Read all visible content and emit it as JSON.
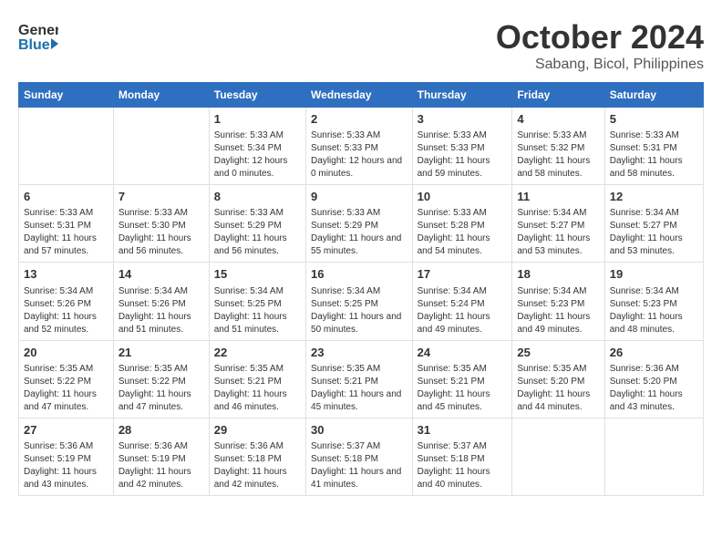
{
  "header": {
    "logo_line1": "General",
    "logo_line2": "Blue",
    "title": "October 2024",
    "subtitle": "Sabang, Bicol, Philippines"
  },
  "days_of_week": [
    "Sunday",
    "Monday",
    "Tuesday",
    "Wednesday",
    "Thursday",
    "Friday",
    "Saturday"
  ],
  "weeks": [
    [
      {
        "day": "",
        "sunrise": "",
        "sunset": "",
        "daylight": ""
      },
      {
        "day": "",
        "sunrise": "",
        "sunset": "",
        "daylight": ""
      },
      {
        "day": "1",
        "sunrise": "Sunrise: 5:33 AM",
        "sunset": "Sunset: 5:34 PM",
        "daylight": "Daylight: 12 hours and 0 minutes."
      },
      {
        "day": "2",
        "sunrise": "Sunrise: 5:33 AM",
        "sunset": "Sunset: 5:33 PM",
        "daylight": "Daylight: 12 hours and 0 minutes."
      },
      {
        "day": "3",
        "sunrise": "Sunrise: 5:33 AM",
        "sunset": "Sunset: 5:33 PM",
        "daylight": "Daylight: 11 hours and 59 minutes."
      },
      {
        "day": "4",
        "sunrise": "Sunrise: 5:33 AM",
        "sunset": "Sunset: 5:32 PM",
        "daylight": "Daylight: 11 hours and 58 minutes."
      },
      {
        "day": "5",
        "sunrise": "Sunrise: 5:33 AM",
        "sunset": "Sunset: 5:31 PM",
        "daylight": "Daylight: 11 hours and 58 minutes."
      }
    ],
    [
      {
        "day": "6",
        "sunrise": "Sunrise: 5:33 AM",
        "sunset": "Sunset: 5:31 PM",
        "daylight": "Daylight: 11 hours and 57 minutes."
      },
      {
        "day": "7",
        "sunrise": "Sunrise: 5:33 AM",
        "sunset": "Sunset: 5:30 PM",
        "daylight": "Daylight: 11 hours and 56 minutes."
      },
      {
        "day": "8",
        "sunrise": "Sunrise: 5:33 AM",
        "sunset": "Sunset: 5:29 PM",
        "daylight": "Daylight: 11 hours and 56 minutes."
      },
      {
        "day": "9",
        "sunrise": "Sunrise: 5:33 AM",
        "sunset": "Sunset: 5:29 PM",
        "daylight": "Daylight: 11 hours and 55 minutes."
      },
      {
        "day": "10",
        "sunrise": "Sunrise: 5:33 AM",
        "sunset": "Sunset: 5:28 PM",
        "daylight": "Daylight: 11 hours and 54 minutes."
      },
      {
        "day": "11",
        "sunrise": "Sunrise: 5:34 AM",
        "sunset": "Sunset: 5:27 PM",
        "daylight": "Daylight: 11 hours and 53 minutes."
      },
      {
        "day": "12",
        "sunrise": "Sunrise: 5:34 AM",
        "sunset": "Sunset: 5:27 PM",
        "daylight": "Daylight: 11 hours and 53 minutes."
      }
    ],
    [
      {
        "day": "13",
        "sunrise": "Sunrise: 5:34 AM",
        "sunset": "Sunset: 5:26 PM",
        "daylight": "Daylight: 11 hours and 52 minutes."
      },
      {
        "day": "14",
        "sunrise": "Sunrise: 5:34 AM",
        "sunset": "Sunset: 5:26 PM",
        "daylight": "Daylight: 11 hours and 51 minutes."
      },
      {
        "day": "15",
        "sunrise": "Sunrise: 5:34 AM",
        "sunset": "Sunset: 5:25 PM",
        "daylight": "Daylight: 11 hours and 51 minutes."
      },
      {
        "day": "16",
        "sunrise": "Sunrise: 5:34 AM",
        "sunset": "Sunset: 5:25 PM",
        "daylight": "Daylight: 11 hours and 50 minutes."
      },
      {
        "day": "17",
        "sunrise": "Sunrise: 5:34 AM",
        "sunset": "Sunset: 5:24 PM",
        "daylight": "Daylight: 11 hours and 49 minutes."
      },
      {
        "day": "18",
        "sunrise": "Sunrise: 5:34 AM",
        "sunset": "Sunset: 5:23 PM",
        "daylight": "Daylight: 11 hours and 49 minutes."
      },
      {
        "day": "19",
        "sunrise": "Sunrise: 5:34 AM",
        "sunset": "Sunset: 5:23 PM",
        "daylight": "Daylight: 11 hours and 48 minutes."
      }
    ],
    [
      {
        "day": "20",
        "sunrise": "Sunrise: 5:35 AM",
        "sunset": "Sunset: 5:22 PM",
        "daylight": "Daylight: 11 hours and 47 minutes."
      },
      {
        "day": "21",
        "sunrise": "Sunrise: 5:35 AM",
        "sunset": "Sunset: 5:22 PM",
        "daylight": "Daylight: 11 hours and 47 minutes."
      },
      {
        "day": "22",
        "sunrise": "Sunrise: 5:35 AM",
        "sunset": "Sunset: 5:21 PM",
        "daylight": "Daylight: 11 hours and 46 minutes."
      },
      {
        "day": "23",
        "sunrise": "Sunrise: 5:35 AM",
        "sunset": "Sunset: 5:21 PM",
        "daylight": "Daylight: 11 hours and 45 minutes."
      },
      {
        "day": "24",
        "sunrise": "Sunrise: 5:35 AM",
        "sunset": "Sunset: 5:21 PM",
        "daylight": "Daylight: 11 hours and 45 minutes."
      },
      {
        "day": "25",
        "sunrise": "Sunrise: 5:35 AM",
        "sunset": "Sunset: 5:20 PM",
        "daylight": "Daylight: 11 hours and 44 minutes."
      },
      {
        "day": "26",
        "sunrise": "Sunrise: 5:36 AM",
        "sunset": "Sunset: 5:20 PM",
        "daylight": "Daylight: 11 hours and 43 minutes."
      }
    ],
    [
      {
        "day": "27",
        "sunrise": "Sunrise: 5:36 AM",
        "sunset": "Sunset: 5:19 PM",
        "daylight": "Daylight: 11 hours and 43 minutes."
      },
      {
        "day": "28",
        "sunrise": "Sunrise: 5:36 AM",
        "sunset": "Sunset: 5:19 PM",
        "daylight": "Daylight: 11 hours and 42 minutes."
      },
      {
        "day": "29",
        "sunrise": "Sunrise: 5:36 AM",
        "sunset": "Sunset: 5:18 PM",
        "daylight": "Daylight: 11 hours and 42 minutes."
      },
      {
        "day": "30",
        "sunrise": "Sunrise: 5:37 AM",
        "sunset": "Sunset: 5:18 PM",
        "daylight": "Daylight: 11 hours and 41 minutes."
      },
      {
        "day": "31",
        "sunrise": "Sunrise: 5:37 AM",
        "sunset": "Sunset: 5:18 PM",
        "daylight": "Daylight: 11 hours and 40 minutes."
      },
      {
        "day": "",
        "sunrise": "",
        "sunset": "",
        "daylight": ""
      },
      {
        "day": "",
        "sunrise": "",
        "sunset": "",
        "daylight": ""
      }
    ]
  ]
}
